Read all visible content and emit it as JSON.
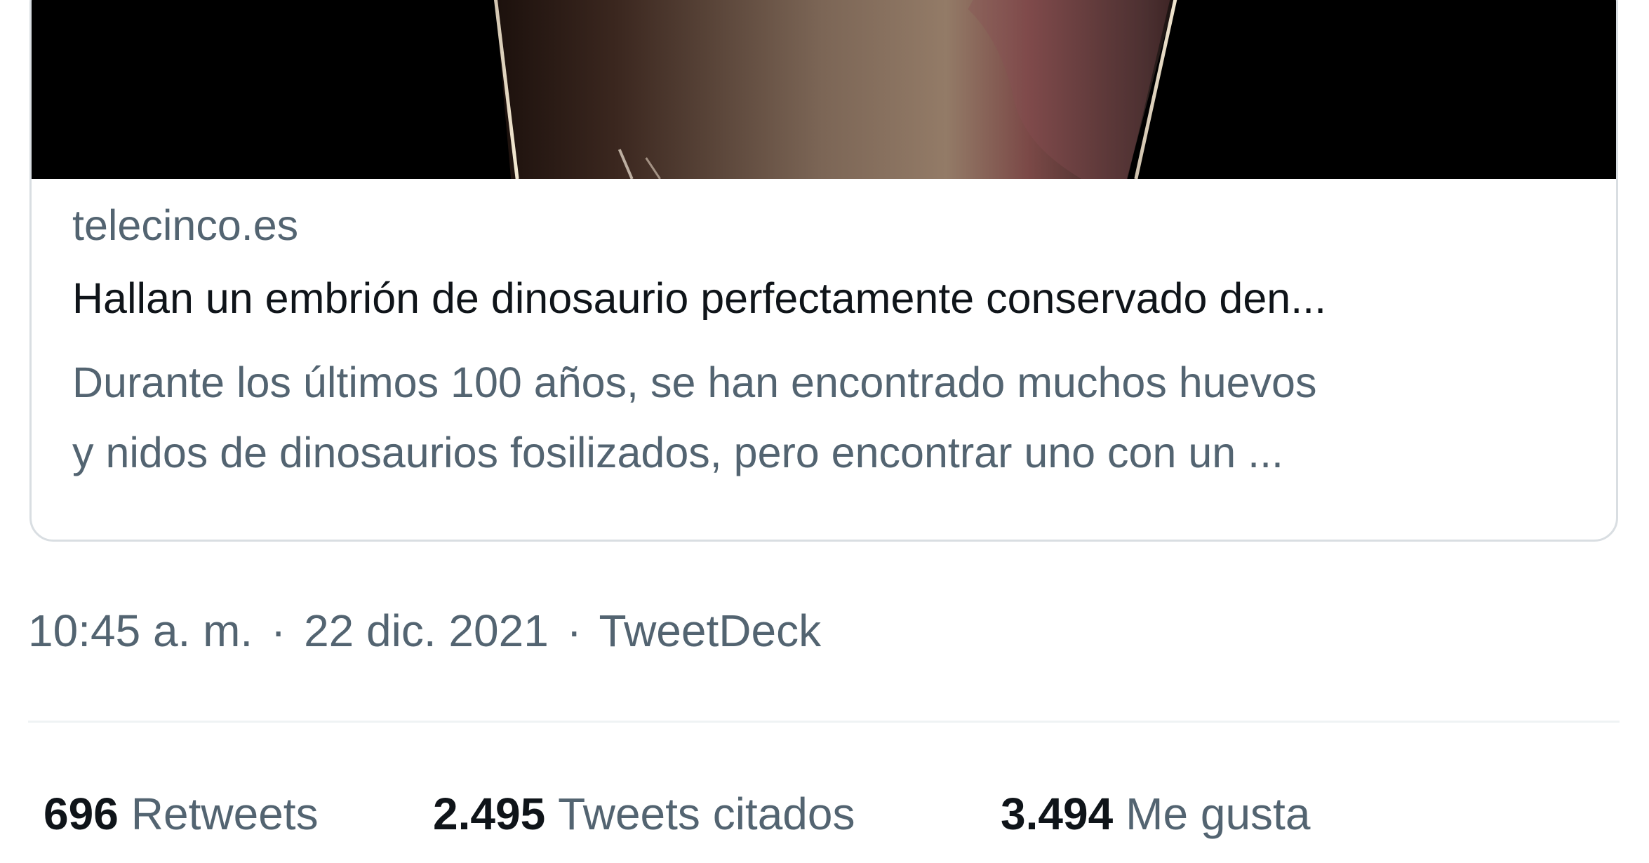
{
  "link_card": {
    "domain": "telecinco.es",
    "title": "Hallan un embrión de dinosaurio perfectamente conservado den...",
    "description_lines": [
      "Durante los últimos 100 años, se han encontrado muchos huevos",
      "y nidos de dinosaurios fosilizados, pero encontrar uno con un ..."
    ]
  },
  "tweet_meta": {
    "time": "10:45 a. m.",
    "separator_1": "·",
    "date": "22 dic. 2021",
    "separator_2": "·",
    "source": "TweetDeck"
  },
  "stats": {
    "retweets": {
      "count": "696",
      "label": "Retweets"
    },
    "quote_tweets": {
      "count": "2.495",
      "label": "Tweets citados"
    },
    "likes": {
      "count": "3.494",
      "label": "Me gusta"
    }
  }
}
